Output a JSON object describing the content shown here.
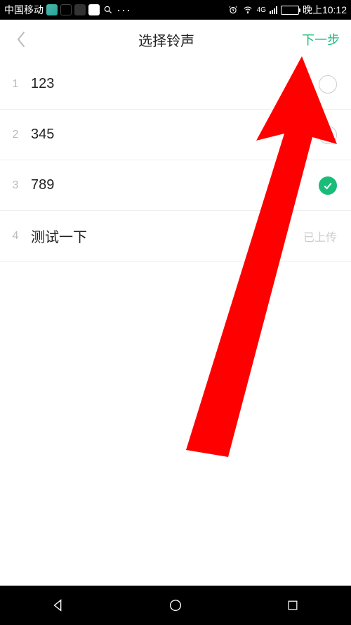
{
  "status_bar": {
    "carrier": "中国移动",
    "time": "晚上10:12",
    "network": "4G"
  },
  "header": {
    "title": "选择铃声",
    "next": "下一步"
  },
  "list": [
    {
      "num": "1",
      "label": "123",
      "selected": false,
      "status": "radio"
    },
    {
      "num": "2",
      "label": "345",
      "selected": false,
      "status": "radio"
    },
    {
      "num": "3",
      "label": "789",
      "selected": true,
      "status": "radio"
    },
    {
      "num": "4",
      "label": "测试一下",
      "selected": false,
      "status": "uploaded",
      "status_text": "已上传"
    }
  ],
  "colors": {
    "accent": "#1abc7a",
    "arrow": "#ff0000"
  }
}
